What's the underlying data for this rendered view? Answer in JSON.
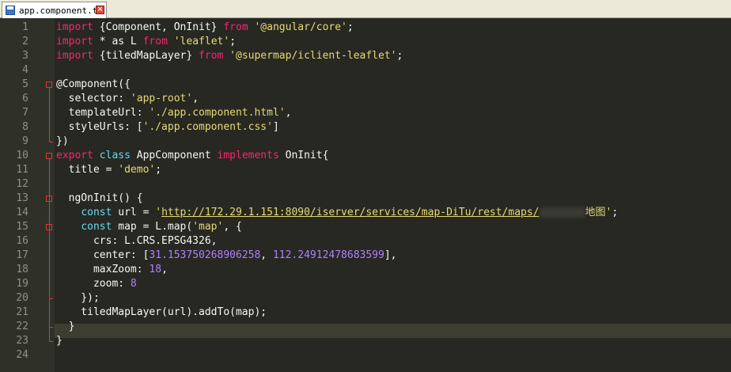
{
  "tab": {
    "title": "app.component.ts",
    "icon": "floppy-disk-icon",
    "close_icon": "close-icon"
  },
  "editor": {
    "theme": "dark",
    "colors": {
      "background": "#272822",
      "keyword": "#66D9EF",
      "string": "#E6DB74",
      "number": "#AE81FF",
      "text": "#F8F8F2",
      "import": "#F92672"
    },
    "line_numbers": [
      "1",
      "2",
      "3",
      "4",
      "5",
      "6",
      "7",
      "8",
      "9",
      "10",
      "11",
      "12",
      "13",
      "14",
      "15",
      "16",
      "17",
      "18",
      "19",
      "20",
      "21",
      "22",
      "23",
      "24"
    ],
    "lines": [
      [
        {
          "t": "import",
          "c": "imp"
        },
        {
          "t": " {Component, OnInit} ",
          "c": "plain"
        },
        {
          "t": "from",
          "c": "imp"
        },
        {
          "t": " ",
          "c": "plain"
        },
        {
          "t": "'@angular/core'",
          "c": "str"
        },
        {
          "t": ";",
          "c": "plain"
        }
      ],
      [
        {
          "t": "import",
          "c": "imp"
        },
        {
          "t": " * as L ",
          "c": "plain"
        },
        {
          "t": "from",
          "c": "imp"
        },
        {
          "t": " ",
          "c": "plain"
        },
        {
          "t": "'leaflet'",
          "c": "str"
        },
        {
          "t": ";",
          "c": "plain"
        }
      ],
      [
        {
          "t": "import",
          "c": "imp"
        },
        {
          "t": " {tiledMapLayer} ",
          "c": "plain"
        },
        {
          "t": "from",
          "c": "imp"
        },
        {
          "t": " ",
          "c": "plain"
        },
        {
          "t": "'@supermap/iclient-leaflet'",
          "c": "str"
        },
        {
          "t": ";",
          "c": "plain"
        }
      ],
      [],
      [
        {
          "t": "@Component({",
          "c": "plain"
        }
      ],
      [
        {
          "t": "  selector: ",
          "c": "plain"
        },
        {
          "t": "'app-root'",
          "c": "str"
        },
        {
          "t": ",",
          "c": "plain"
        }
      ],
      [
        {
          "t": "  templateUrl: ",
          "c": "plain"
        },
        {
          "t": "'./app.component.html'",
          "c": "str"
        },
        {
          "t": ",",
          "c": "plain"
        }
      ],
      [
        {
          "t": "  styleUrls: [",
          "c": "plain"
        },
        {
          "t": "'./app.component.css'",
          "c": "str"
        },
        {
          "t": "]",
          "c": "plain"
        }
      ],
      [
        {
          "t": "})",
          "c": "plain"
        }
      ],
      [
        {
          "t": "export",
          "c": "imp"
        },
        {
          "t": " ",
          "c": "plain"
        },
        {
          "t": "class",
          "c": "kw"
        },
        {
          "t": " AppComponent ",
          "c": "plain"
        },
        {
          "t": "implements",
          "c": "imp"
        },
        {
          "t": " OnInit{",
          "c": "plain"
        }
      ],
      [
        {
          "t": "  title = ",
          "c": "plain"
        },
        {
          "t": "'demo'",
          "c": "str"
        },
        {
          "t": ";",
          "c": "plain"
        }
      ],
      [],
      [
        {
          "t": "  ngOnInit() {",
          "c": "plain"
        }
      ],
      [
        {
          "t": "    ",
          "c": "plain"
        },
        {
          "t": "const",
          "c": "kw"
        },
        {
          "t": " url = ",
          "c": "plain"
        },
        {
          "t": "'",
          "c": "str"
        },
        {
          "t": "http://172.29.1.151:8090/iserver/services/map-DiTu/rest/maps/",
          "c": "url"
        },
        {
          "t": "BLUR",
          "c": "blur"
        },
        {
          "t": "地图",
          "c": "str"
        },
        {
          "t": "'",
          "c": "str"
        },
        {
          "t": ";",
          "c": "plain"
        }
      ],
      [
        {
          "t": "    ",
          "c": "plain"
        },
        {
          "t": "const",
          "c": "kw"
        },
        {
          "t": " map = L.map(",
          "c": "plain"
        },
        {
          "t": "'map'",
          "c": "str"
        },
        {
          "t": ", {",
          "c": "plain"
        }
      ],
      [
        {
          "t": "      crs: L.CRS.EPSG4326,",
          "c": "plain"
        }
      ],
      [
        {
          "t": "      center: [",
          "c": "plain"
        },
        {
          "t": "31.153750268906258",
          "c": "num"
        },
        {
          "t": ", ",
          "c": "plain"
        },
        {
          "t": "112.24912478683599",
          "c": "num"
        },
        {
          "t": "],",
          "c": "plain"
        }
      ],
      [
        {
          "t": "      maxZoom: ",
          "c": "plain"
        },
        {
          "t": "18",
          "c": "num"
        },
        {
          "t": ",",
          "c": "plain"
        }
      ],
      [
        {
          "t": "      zoom: ",
          "c": "plain"
        },
        {
          "t": "8",
          "c": "num"
        }
      ],
      [
        {
          "t": "    });",
          "c": "plain"
        }
      ],
      [
        {
          "t": "    tiledMapLayer(url).addTo(map);",
          "c": "plain"
        }
      ],
      [
        {
          "t": "  }",
          "c": "plain"
        }
      ],
      [
        {
          "t": "}",
          "c": "plain"
        }
      ],
      []
    ]
  }
}
